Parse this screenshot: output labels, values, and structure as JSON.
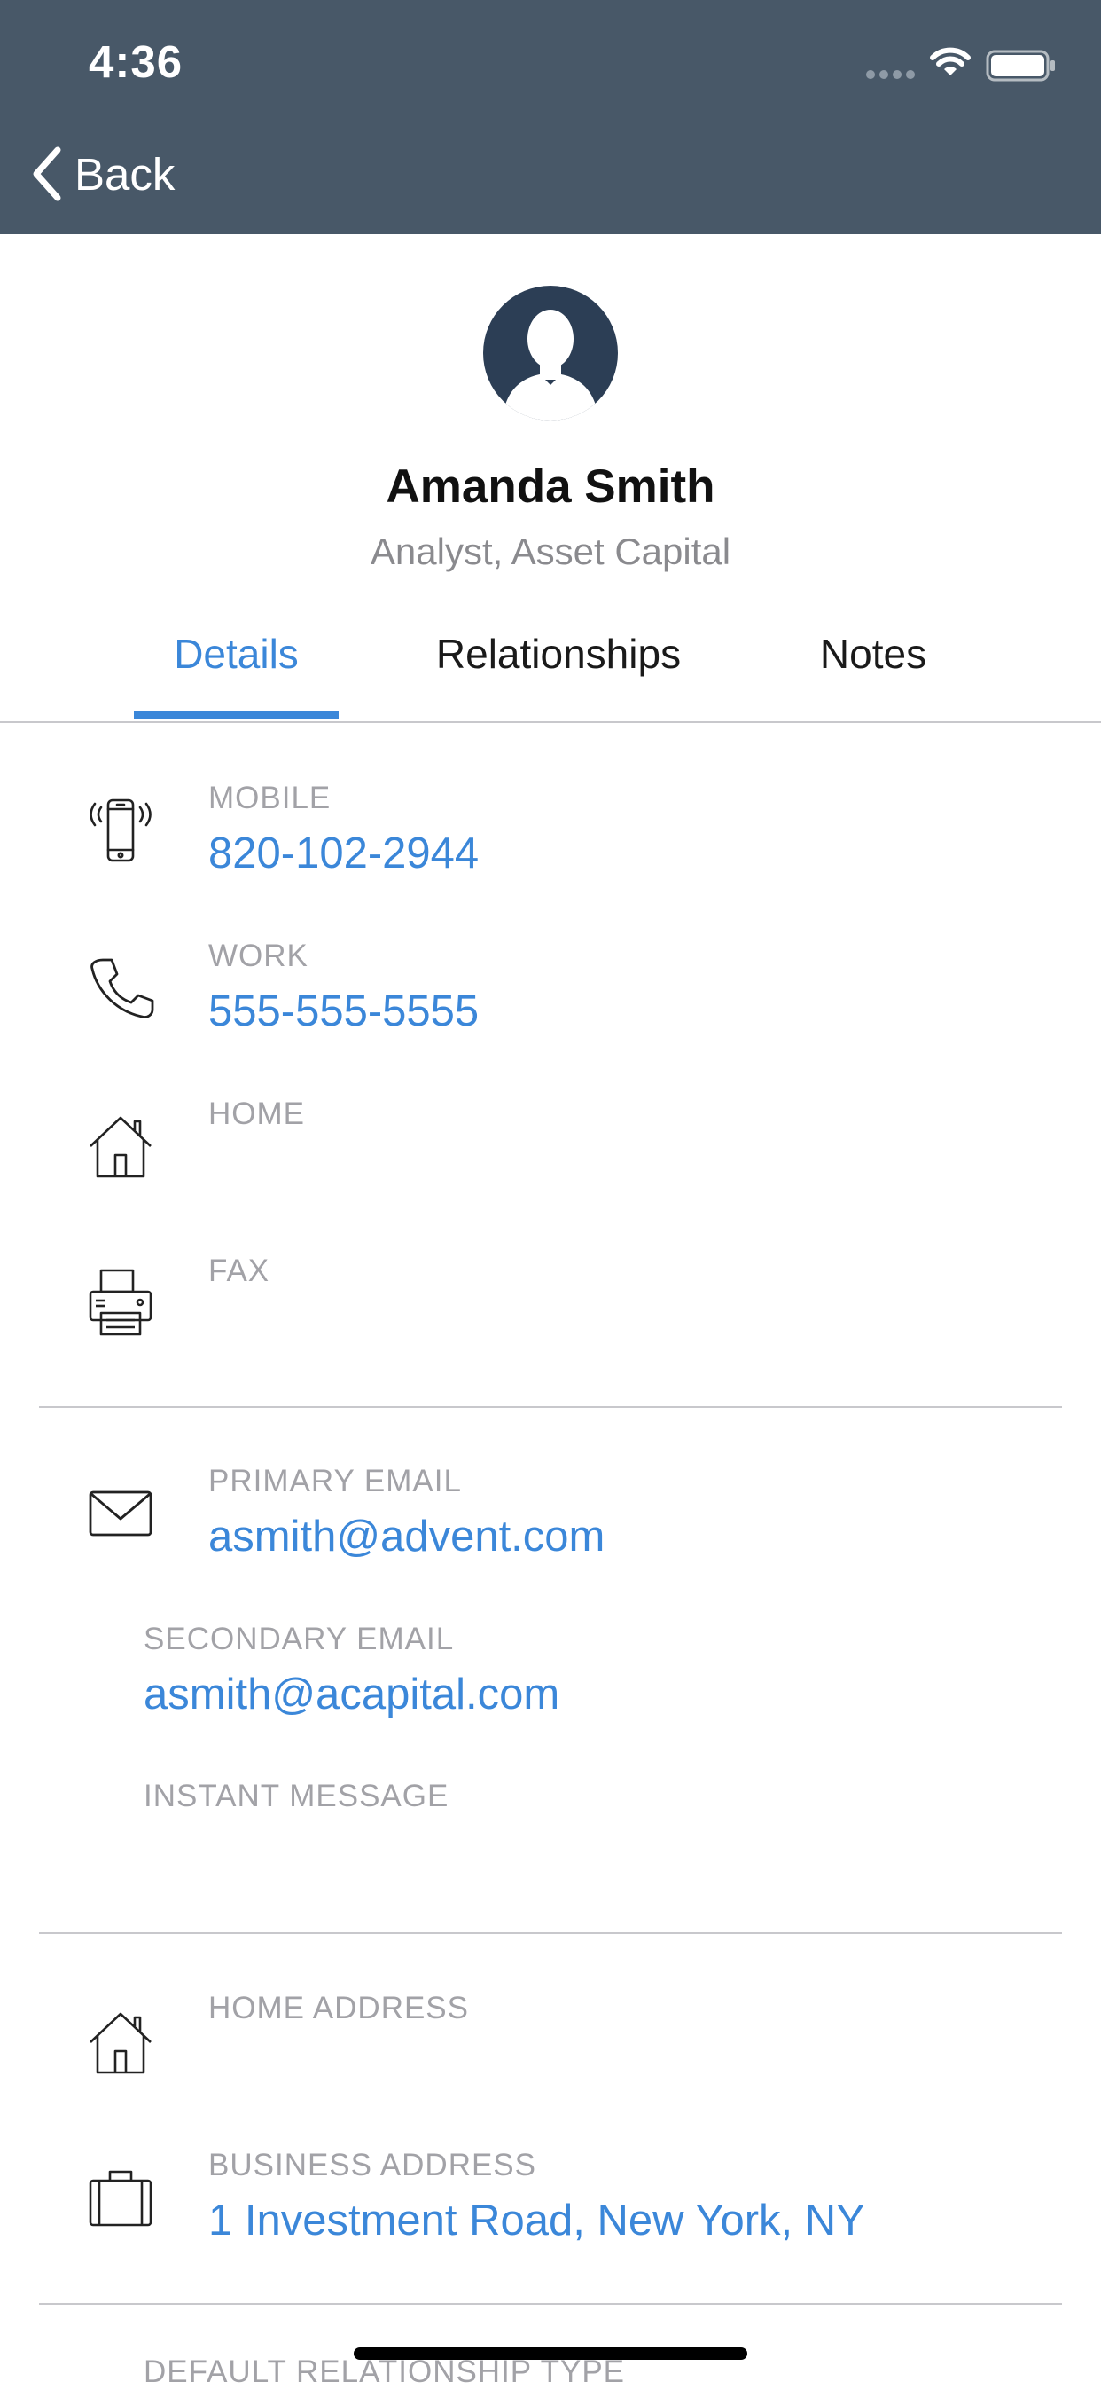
{
  "status_bar": {
    "time": "4:36"
  },
  "nav": {
    "back_label": "Back"
  },
  "profile": {
    "name": "Amanda Smith",
    "subtitle": "Analyst, Asset Capital"
  },
  "tabs": [
    {
      "label": "Details",
      "active": true
    },
    {
      "label": "Relationships",
      "active": false
    },
    {
      "label": "Notes",
      "active": false
    }
  ],
  "phones": {
    "mobile": {
      "label": "MOBILE",
      "value": "820-102-2944",
      "icon": "mobile-phone-icon"
    },
    "work": {
      "label": "WORK",
      "value": "555-555-5555",
      "icon": "phone-icon"
    },
    "home": {
      "label": "HOME",
      "value": "",
      "icon": "house-icon"
    },
    "fax": {
      "label": "FAX",
      "value": "",
      "icon": "fax-icon"
    }
  },
  "emails": {
    "primary": {
      "label": "PRIMARY EMAIL",
      "value": "asmith@advent.com",
      "icon": "envelope-icon"
    },
    "secondary": {
      "label": "SECONDARY EMAIL",
      "value": "asmith@acapital.com"
    },
    "instant_message": {
      "label": "INSTANT MESSAGE",
      "value": ""
    }
  },
  "addresses": {
    "home": {
      "label": "HOME ADDRESS",
      "value": "",
      "icon": "house-icon"
    },
    "business": {
      "label": "BUSINESS ADDRESS",
      "value": "1 Investment Road, New York, NY",
      "icon": "briefcase-icon"
    }
  },
  "relationship": {
    "label": "DEFAULT RELATIONSHIP TYPE"
  },
  "colors": {
    "header": "#485868",
    "accent": "#3b87d9",
    "label": "#a2a2a7",
    "avatar": "#2c3e55"
  }
}
